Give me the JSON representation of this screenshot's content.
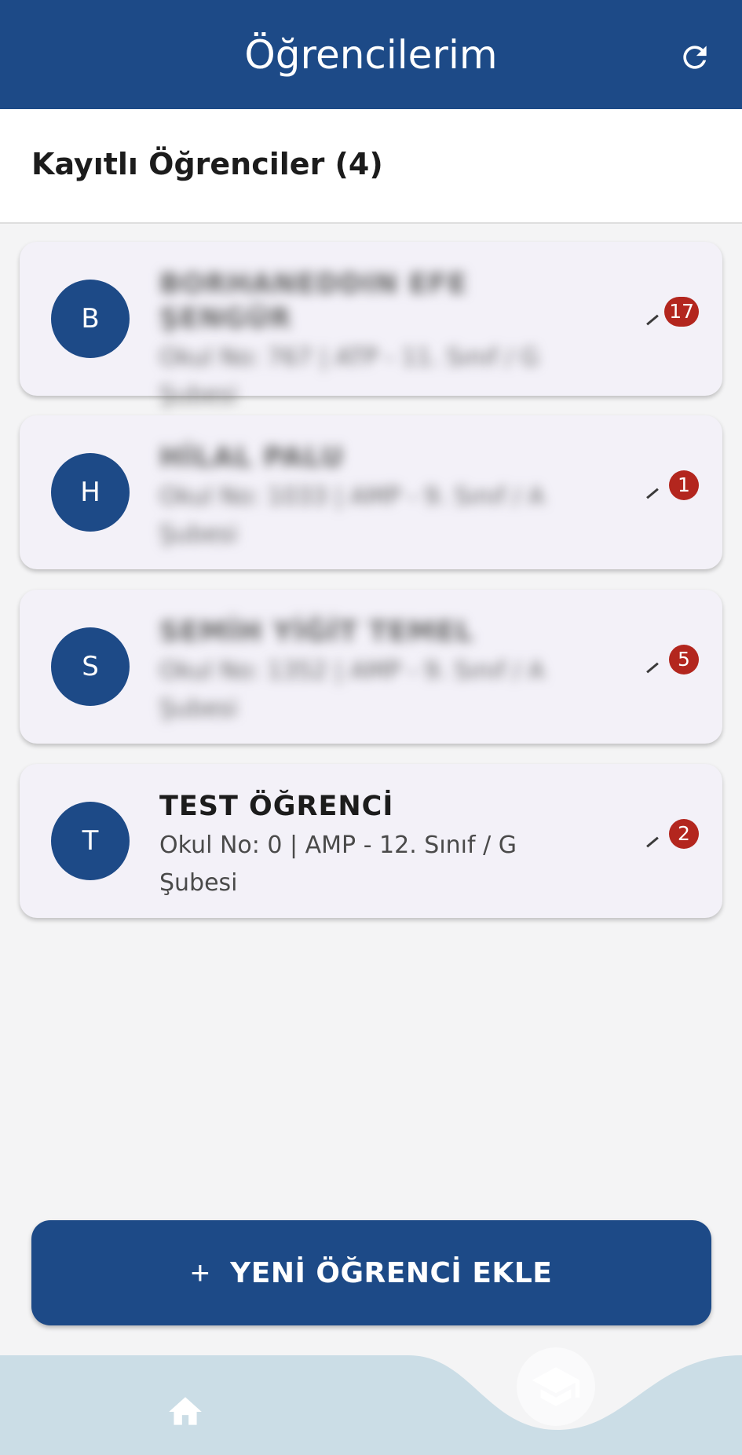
{
  "appbar": {
    "title": "Öğrencilerim",
    "refresh_icon": "refresh-icon",
    "background": "#1d4a87"
  },
  "subheader": {
    "title": "Kayıtlı Öğrenciler (4)"
  },
  "students": [
    {
      "initial": "B",
      "name": "BORHANEDDIN EFE ŞENGÜR",
      "detail_line1": "Okul No: 767 | ATP - 11. Sınıf / G",
      "detail_line2": "Şubesi",
      "badge": "17",
      "blurred": true
    },
    {
      "initial": "H",
      "name": "HİLAL PALU",
      "detail_line1": "Okul No: 1033 | AMP - 9. Sınıf / A",
      "detail_line2": "Şubesi",
      "badge": "1",
      "blurred": true
    },
    {
      "initial": "S",
      "name": "SEMİH YİĞİT TEMEL",
      "detail_line1": "Okul No: 1352 | AMP - 9. Sınıf / A",
      "detail_line2": "Şubesi",
      "badge": "5",
      "blurred": true
    },
    {
      "initial": "T",
      "name": "TEST ÖĞRENCİ",
      "detail_line1": "Okul No: 0 | AMP - 12. Sınıf / G",
      "detail_line2": "Şubesi",
      "badge": "2",
      "blurred": false
    }
  ],
  "add_button": {
    "plus": "+",
    "label": "YENİ ÖĞRENCİ EKLE"
  },
  "bottom_nav": {
    "items": [
      {
        "icon": "home-icon"
      },
      {
        "icon": "graduation-cap-icon",
        "active": true
      }
    ],
    "background": "#cbdde6"
  },
  "colors": {
    "primary": "#1d4a87",
    "badge": "#b3261e",
    "card": "#f3f1f8",
    "page": "#f4f4f5"
  }
}
